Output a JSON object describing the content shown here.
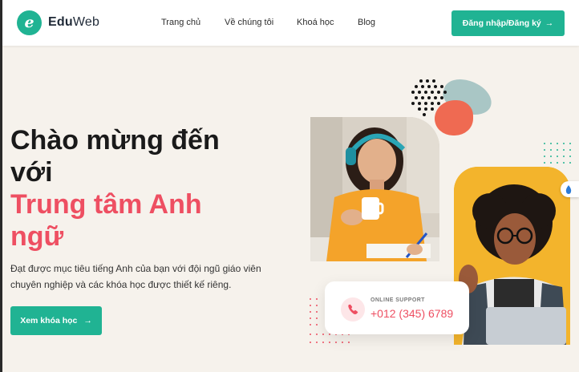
{
  "brand": {
    "logo_letter": "e",
    "name_bold": "Edu",
    "name_rest": "Web"
  },
  "nav": {
    "items": [
      {
        "label": "Trang chủ"
      },
      {
        "label": "Về chúng tôi"
      },
      {
        "label": "Khoá học"
      },
      {
        "label": "Blog"
      }
    ],
    "login_label": "Đăng nhập/Đăng ký",
    "login_arrow": "→"
  },
  "hero": {
    "title_line1": "Chào mừng đến",
    "title_line2": "với",
    "title_line3": "Trung tâm Anh",
    "title_line4": "ngữ",
    "description": "Đạt được mục tiêu tiếng Anh của bạn với đội ngũ giáo viên chuyên nghiệp và các khóa học được thiết kế riêng.",
    "cta_label": "Xem khóa học",
    "cta_arrow": "→"
  },
  "support": {
    "label": "ONLINE SUPPORT",
    "phone": "+012 (345) 6789",
    "icon": "phone-icon"
  },
  "colors": {
    "accent": "#20b393",
    "pink": "#ee4f62",
    "background": "#f6f2ec",
    "orange": "#ef6a52",
    "yellow": "#f3b42c",
    "sage": "#a9c6c5"
  }
}
